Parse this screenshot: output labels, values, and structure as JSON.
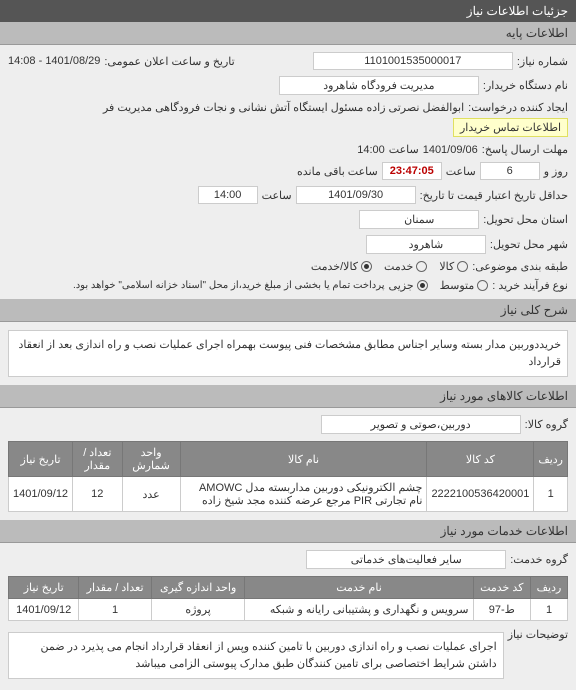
{
  "headers": {
    "main": "جزئیات اطلاعات نیاز",
    "basic": "اطلاعات پایه",
    "general_desc": "شرح کلی نیاز",
    "goods_info": "اطلاعات کالاهای مورد نیاز",
    "services_info": "اطلاعات خدمات مورد نیاز"
  },
  "labels": {
    "need_number": "شماره نیاز:",
    "announce_date": "تاریخ و ساعت اعلان عمومی:",
    "buyer_name": "نام دستگاه خریدار:",
    "creator": "ایجاد کننده درخواست:",
    "deadline": "مهلت ارسال پاسخ:",
    "day_hour": "روز و",
    "hour": "ساعت",
    "remaining": "ساعت باقی مانده",
    "date": "تاریخ:",
    "validity_from": "حداقل تاریخ اعتبار قیمت تا تاریخ:",
    "province": "استان محل تحویل:",
    "city": "شهر محل تحویل:",
    "budget_type": "طبقه بندی موضوعی:",
    "purchase_type": "نوع فرآیند خرید :",
    "payment_note": "پرداخت تمام یا بخشی از مبلغ خرید،از محل \"اسناد خزانه اسلامی\" خواهد بود.",
    "goods_group": "گروه کالا:",
    "services_group": "گروه خدمت:",
    "notes": "توضیحات نیاز",
    "buyer_info": "اطلاعات تماس خریدار"
  },
  "values": {
    "need_number": "1101001535000017",
    "announce_date": "1401/08/29 - 14:08",
    "buyer_name": "مدیریت فرودگاه شاهرود",
    "creator": "ابوالفضل نصرتی زاده مسئول ایستگاه آتش نشانی و نجات فرودگاهی مدیریت فر",
    "deadline_date": "1401/09/06",
    "deadline_hour": "14:00",
    "day_count": "6",
    "remaining": "23:47:05",
    "validity_date": "1401/09/30",
    "validity_hour": "14:00",
    "province": "سمنان",
    "city": "شاهرود",
    "goods_group": "دوربین،صوتی و تصویر",
    "services_group": "سایر فعالیت‌های خدماتی"
  },
  "budget_options": {
    "goods": "کالا",
    "service": "خدمت",
    "both": "کالا/خدمت"
  },
  "purchase_options": {
    "mid": "متوسط",
    "minor": "جزیی"
  },
  "general_desc": "خریددوربین مدار بسته وسایر اجناس مطابق مشخصات فنی پیوست بهمراه اجرای عملیات نصب و راه اندازی بعد از انعقاد قرارداد",
  "goods_table": {
    "cols": {
      "row": "ردیف",
      "code": "کد کالا",
      "name": "نام کالا",
      "unit": "واحد شمارش",
      "qty": "تعداد / مقدار",
      "date": "تاریخ نیاز"
    },
    "rows": [
      {
        "row": "1",
        "code": "2222100536420001",
        "name": "چشم الکترونیکی دوربین مداربسته مدل AMOWC نام تجارتی PIR مرجع عرضه کننده مجد شیخ زاده",
        "unit": "عدد",
        "qty": "12",
        "date": "1401/09/12"
      }
    ]
  },
  "services_table": {
    "cols": {
      "row": "ردیف",
      "code": "کد خدمت",
      "name": "نام خدمت",
      "unit": "واحد اندازه گیری",
      "qty": "تعداد / مقدار",
      "date": "تاریخ نیاز"
    },
    "rows": [
      {
        "row": "1",
        "code": "ط-97",
        "name": "سرویس و نگهداری و پشتیبانی رایانه و شبکه",
        "unit": "پروژه",
        "qty": "1",
        "date": "1401/09/12"
      }
    ]
  },
  "notes": "اجرای عملیات نصب و راه اندازی دوربین با تامین کننده وپس از انعقاد قرارداد انجام می پذیرد در ضمن داشتن شرایط اختصاصی برای تامین کنندگان طبق مدارک پیوستی الزامی میباشد"
}
